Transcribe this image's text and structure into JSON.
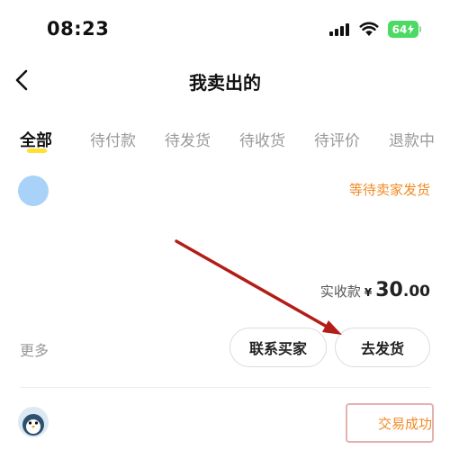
{
  "status_bar": {
    "time": "08:23",
    "battery": "64"
  },
  "nav": {
    "title": "我卖出的"
  },
  "tabs": [
    {
      "label": "全部",
      "active": true
    },
    {
      "label": "待付款"
    },
    {
      "label": "待发货"
    },
    {
      "label": "待收货"
    },
    {
      "label": "待评价"
    },
    {
      "label": "退款中"
    }
  ],
  "orders": [
    {
      "status": "等待卖家发货",
      "amount_label": "实收款",
      "currency": "¥",
      "amount_int": "30",
      "amount_dec": ".00",
      "more": "更多",
      "buttons": {
        "contact": "联系买家",
        "ship": "去发货"
      }
    },
    {
      "status": "交易成功"
    }
  ],
  "colors": {
    "accent_yellow": "#ffe033",
    "status_orange": "#f08a24",
    "battery_green": "#4cd964",
    "arrow_red": "#b31d17"
  }
}
